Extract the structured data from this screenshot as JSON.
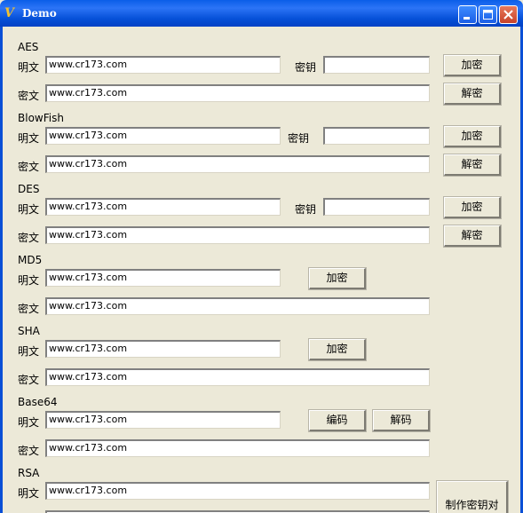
{
  "window": {
    "title": "Demo",
    "app_icon": "vb-icon"
  },
  "aes": {
    "section": "AES",
    "plain_label": "明文",
    "plain_value": "www.cr173.com",
    "key_label": "密钥",
    "key_value": "",
    "cipher_label": "密文",
    "cipher_value": "www.cr173.com",
    "encrypt": "加密",
    "decrypt": "解密"
  },
  "blowfish": {
    "section": "BlowFish",
    "plain_label": "明文",
    "plain_value": "www.cr173.com",
    "key_label": "密钥",
    "key_value": "",
    "cipher_label": "密文",
    "cipher_value": "www.cr173.com",
    "encrypt": "加密",
    "decrypt": "解密"
  },
  "des": {
    "section": "DES",
    "plain_label": "明文",
    "plain_value": "www.cr173.com",
    "key_label": "密钥",
    "key_value": "",
    "cipher_label": "密文",
    "cipher_value": "www.cr173.com",
    "encrypt": "加密",
    "decrypt": "解密"
  },
  "md5": {
    "section": "MD5",
    "plain_label": "明文",
    "plain_value": "www.cr173.com",
    "cipher_label": "密文",
    "cipher_value": "www.cr173.com",
    "encrypt": "加密"
  },
  "sha": {
    "section": "SHA",
    "plain_label": "明文",
    "plain_value": "www.cr173.com",
    "cipher_label": "密文",
    "cipher_value": "www.cr173.com",
    "encrypt": "加密"
  },
  "base64": {
    "section": "Base64",
    "plain_label": "明文",
    "plain_value": "www.cr173.com",
    "cipher_label": "密文",
    "cipher_value": "www.cr173.com",
    "encode": "编码",
    "decode": "解码"
  },
  "rsa": {
    "section": "RSA",
    "plain_label": "明文",
    "plain_value": "www.cr173.com",
    "make_keypair": "制作密钥对"
  }
}
